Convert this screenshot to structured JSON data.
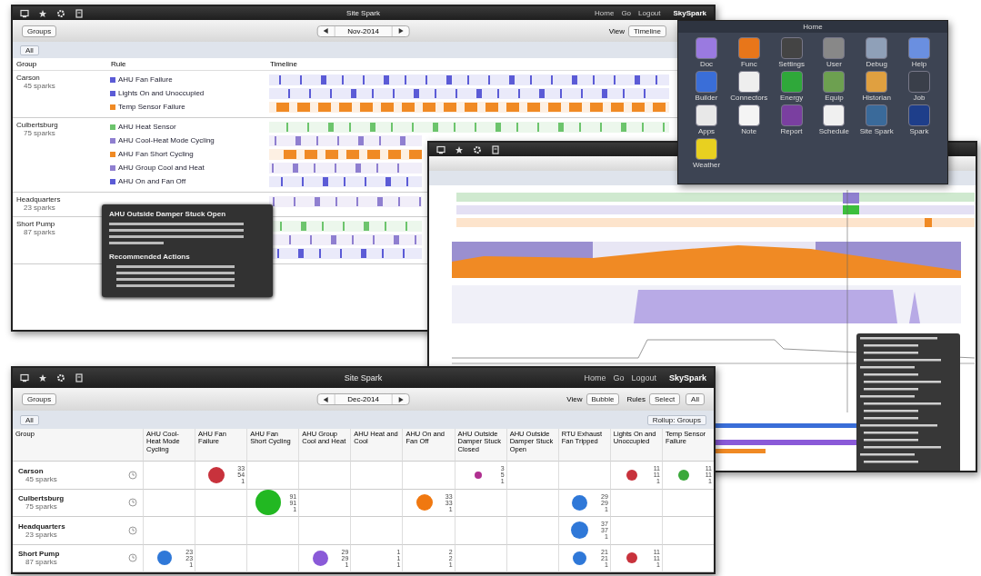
{
  "timeline_window": {
    "title": "Site Spark",
    "nav": [
      "Home",
      "Go",
      "Logout"
    ],
    "brand": "SkySpark",
    "toolbar_button": "Groups",
    "date": "Nov-2014",
    "view_label": "View",
    "view_button": "Timeline",
    "filter": "All",
    "columns": [
      "Group",
      "Rule",
      "Timeline"
    ],
    "groups": [
      {
        "name": "Carson",
        "count": "45 sparks",
        "rules": [
          {
            "name": "AHU Fan Failure",
            "color": "#5b5bd6"
          },
          {
            "name": "Lights On and Unoccupied",
            "color": "#5b5bd6"
          },
          {
            "name": "Temp Sensor Failure",
            "color": "#f08a24"
          }
        ]
      },
      {
        "name": "Culbertsburg",
        "count": "75 sparks",
        "rules": [
          {
            "name": "AHU Heat Sensor",
            "color": "#6cc46c"
          },
          {
            "name": "AHU Cool-Heat Mode Cycling",
            "color": "#8f7fd0"
          },
          {
            "name": "AHU Fan Short Cycling",
            "color": "#f08a24"
          },
          {
            "name": "AHU Group Cool and Heat",
            "color": "#8f7fd0"
          },
          {
            "name": "AHU On and Fan Off",
            "color": "#5b5bd6"
          }
        ]
      },
      {
        "name": "Headquarters",
        "count": "23 sparks",
        "rules": [
          {
            "color": "#8f7fd0"
          }
        ]
      },
      {
        "name": "Short Pump",
        "count": "87 sparks",
        "rules": [
          {
            "color": "#6cc46c"
          },
          {
            "color": "#8f7fd0"
          },
          {
            "color": "#5b5bd6"
          }
        ]
      }
    ],
    "tooltip": {
      "title": "AHU Outside Damper Stuck Open",
      "section": "Recommended Actions"
    }
  },
  "home_window": {
    "title": "Home",
    "apps": [
      {
        "label": "Doc",
        "color": "#9a7ae0"
      },
      {
        "label": "Func",
        "color": "#e8761a"
      },
      {
        "label": "Settings",
        "color": "#444444"
      },
      {
        "label": "User",
        "color": "#888888"
      },
      {
        "label": "Debug",
        "color": "#8fa0b8"
      },
      {
        "label": "Help",
        "color": "#6a8fe0"
      },
      {
        "label": "Builder",
        "color": "#3a6ed8"
      },
      {
        "label": "Connectors",
        "color": "#eeeeee"
      },
      {
        "label": "Energy",
        "color": "#2fa83a"
      },
      {
        "label": "Equip",
        "color": "#6da050"
      },
      {
        "label": "Historian",
        "color": "#e0a040"
      },
      {
        "label": "Job",
        "color": "#3a3f4a"
      },
      {
        "label": "Apps",
        "color": "#e8e8e8"
      },
      {
        "label": "Note",
        "color": "#f4f4f4"
      },
      {
        "label": "Report",
        "color": "#7a3fa0"
      },
      {
        "label": "Schedule",
        "color": "#f0f0f0"
      },
      {
        "label": "Site Spark",
        "color": "#3a6a9a"
      },
      {
        "label": "Spark",
        "color": "#1e3e8a"
      },
      {
        "label": "Weather",
        "color": "#e8d020"
      }
    ]
  },
  "bubble_window": {
    "title": "Site Spark",
    "nav": [
      "Home",
      "Go",
      "Logout"
    ],
    "brand": "SkySpark",
    "toolbar_button": "Groups",
    "date": "Dec-2014",
    "view_label": "View",
    "view_button": "Bubble",
    "rules_label": "Rules",
    "rules_buttons": [
      "Select",
      "All"
    ],
    "filter": "All",
    "rollup": "Rollup: Groups",
    "columns": [
      "Group",
      "AHU Cool-Heat Mode Cycling",
      "AHU Fan Failure",
      "AHU Fan Short Cycling",
      "AHU Group Cool and Heat",
      "AHU Heat and Cool",
      "AHU On and Fan Off",
      "AHU Outside Damper Stuck Closed",
      "AHU Outside Damper Stuck Open",
      "RTU Exhaust Fan Tripped",
      "Lights On and Unoccupied",
      "Temp Sensor Failure"
    ],
    "rows": [
      {
        "name": "Carson",
        "count": "45 sparks",
        "cells": [
          null,
          {
            "color": "#c8323c",
            "counts": [
              "33",
              "54",
              "1"
            ]
          },
          null,
          null,
          null,
          null,
          {
            "color": "#b03090",
            "counts": [
              "3",
              "5",
              "1"
            ]
          },
          null,
          null,
          {
            "color": "#c8323c",
            "counts": [
              "11",
              "11",
              "1"
            ]
          },
          {
            "color": "#3aa83a",
            "counts": [
              "11",
              "11",
              "1"
            ]
          }
        ]
      },
      {
        "name": "Culbertsburg",
        "count": "75 sparks",
        "cells": [
          null,
          null,
          {
            "color": "#22b822",
            "counts": [
              "91",
              "91",
              "1"
            ]
          },
          null,
          null,
          {
            "color": "#f07810",
            "counts": [
              "33",
              "33",
              "1"
            ]
          },
          null,
          null,
          {
            "color": "#2f78d8",
            "counts": [
              "29",
              "29",
              "1"
            ]
          },
          null,
          null
        ]
      },
      {
        "name": "Headquarters",
        "count": "23 sparks",
        "cells": [
          null,
          null,
          null,
          null,
          null,
          null,
          null,
          null,
          {
            "color": "#2f78d8",
            "counts": [
              "37",
              "37",
              "1"
            ]
          },
          null,
          null
        ]
      },
      {
        "name": "Short Pump",
        "count": "87 sparks",
        "cells": [
          {
            "color": "#2f78d8",
            "counts": [
              "23",
              "23",
              "1"
            ]
          },
          null,
          null,
          {
            "color": "#8a5ad8",
            "counts": [
              "29",
              "29",
              "1"
            ]
          },
          {
            "counts": [
              "1",
              "1",
              "1"
            ]
          },
          {
            "counts": [
              "2",
              "2",
              "1"
            ]
          },
          null,
          null,
          {
            "color": "#2f78d8",
            "counts": [
              "21",
              "21",
              "1"
            ]
          },
          {
            "color": "#c8323c",
            "counts": [
              "11",
              "11",
              "1"
            ]
          },
          null
        ]
      }
    ]
  }
}
